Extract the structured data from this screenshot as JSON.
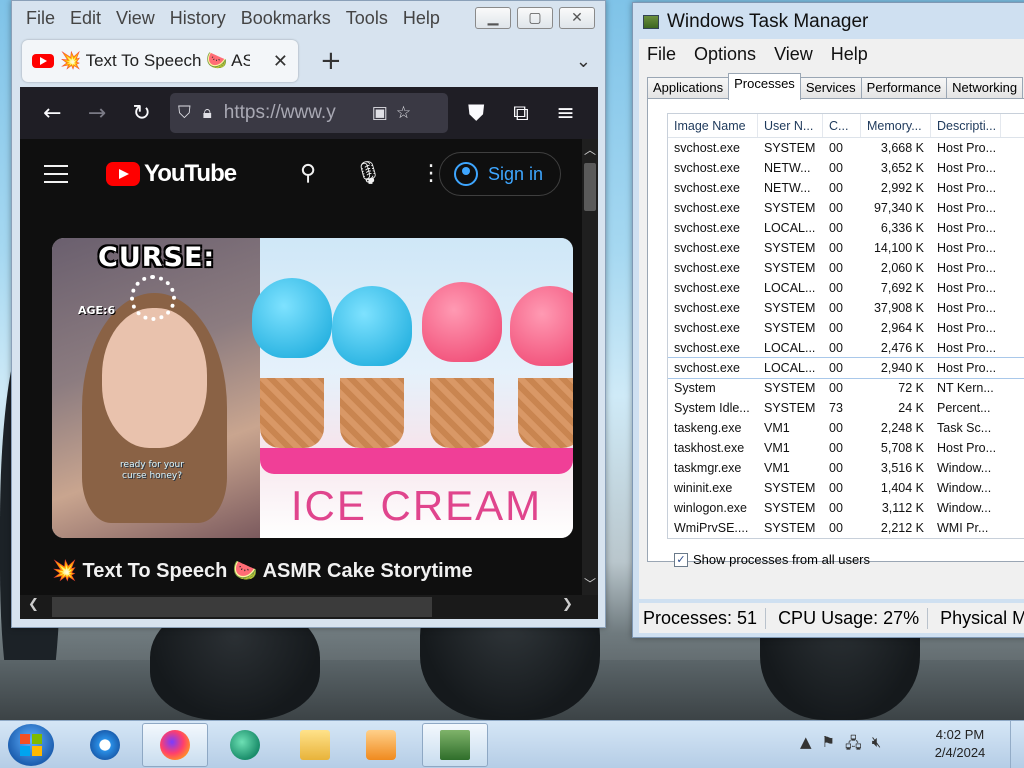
{
  "firefox": {
    "menu": [
      "File",
      "Edit",
      "View",
      "History",
      "Bookmarks",
      "Tools",
      "Help"
    ],
    "tab_title": "💥 Text To Speech 🍉 ASMR",
    "url": "https://www.y",
    "youtube": {
      "logo_text": "YouTube",
      "sign_in": "Sign in",
      "thumb_curse": "CURSE:",
      "thumb_age": "AGE:6",
      "thumb_bubble": "ready for your curse honey?",
      "thumb_ice_cream": "ICE CREAM",
      "video_title": "💥 Text To Speech 🍉 ASMR Cake Storytime"
    }
  },
  "taskmanager": {
    "title": "Windows Task Manager",
    "menu": [
      "File",
      "Options",
      "View",
      "Help"
    ],
    "tabs": [
      "Applications",
      "Processes",
      "Services",
      "Performance",
      "Networking"
    ],
    "active_tab": "Processes",
    "columns": [
      "Image Name",
      "User N...",
      "C...",
      "Memory...",
      "Descripti..."
    ],
    "rows": [
      [
        "svchost.exe",
        "SYSTEM",
        "00",
        "3,668 K",
        "Host Pro..."
      ],
      [
        "svchost.exe",
        "NETW...",
        "00",
        "3,652 K",
        "Host Pro..."
      ],
      [
        "svchost.exe",
        "NETW...",
        "00",
        "2,992 K",
        "Host Pro..."
      ],
      [
        "svchost.exe",
        "SYSTEM",
        "00",
        "97,340 K",
        "Host Pro..."
      ],
      [
        "svchost.exe",
        "LOCAL...",
        "00",
        "6,336 K",
        "Host Pro..."
      ],
      [
        "svchost.exe",
        "SYSTEM",
        "00",
        "14,100 K",
        "Host Pro..."
      ],
      [
        "svchost.exe",
        "SYSTEM",
        "00",
        "2,060 K",
        "Host Pro..."
      ],
      [
        "svchost.exe",
        "LOCAL...",
        "00",
        "7,692 K",
        "Host Pro..."
      ],
      [
        "svchost.exe",
        "SYSTEM",
        "00",
        "37,908 K",
        "Host Pro..."
      ],
      [
        "svchost.exe",
        "SYSTEM",
        "00",
        "2,964 K",
        "Host Pro..."
      ],
      [
        "svchost.exe",
        "LOCAL...",
        "00",
        "2,476 K",
        "Host Pro..."
      ],
      [
        "svchost.exe",
        "LOCAL...",
        "00",
        "2,940 K",
        "Host Pro..."
      ],
      [
        "System",
        "SYSTEM",
        "00",
        "72 K",
        "NT Kern..."
      ],
      [
        "System Idle...",
        "SYSTEM",
        "73",
        "24 K",
        "Percent..."
      ],
      [
        "taskeng.exe",
        "VM1",
        "00",
        "2,248 K",
        "Task Sc..."
      ],
      [
        "taskhost.exe",
        "VM1",
        "00",
        "5,708 K",
        "Host Pro..."
      ],
      [
        "taskmgr.exe",
        "VM1",
        "00",
        "3,516 K",
        "Window..."
      ],
      [
        "wininit.exe",
        "SYSTEM",
        "00",
        "1,404 K",
        "Window..."
      ],
      [
        "winlogon.exe",
        "SYSTEM",
        "00",
        "3,112 K",
        "Window..."
      ],
      [
        "WmiPrvSE....",
        "SYSTEM",
        "00",
        "2,212 K",
        "WMI Pr..."
      ]
    ],
    "show_all_label": "Show processes from all users",
    "show_all_checked": true,
    "status": {
      "processes": "Processes: 51",
      "cpu": "CPU Usage: 27%",
      "physical": "Physical M"
    }
  },
  "taskbar": {
    "icons": [
      "start-icon",
      "internet-explorer-icon",
      "firefox-icon",
      "chat-app-icon",
      "file-explorer-icon",
      "media-player-icon",
      "task-manager-icon"
    ],
    "time": "4:02 PM",
    "date": "2/4/2024"
  }
}
